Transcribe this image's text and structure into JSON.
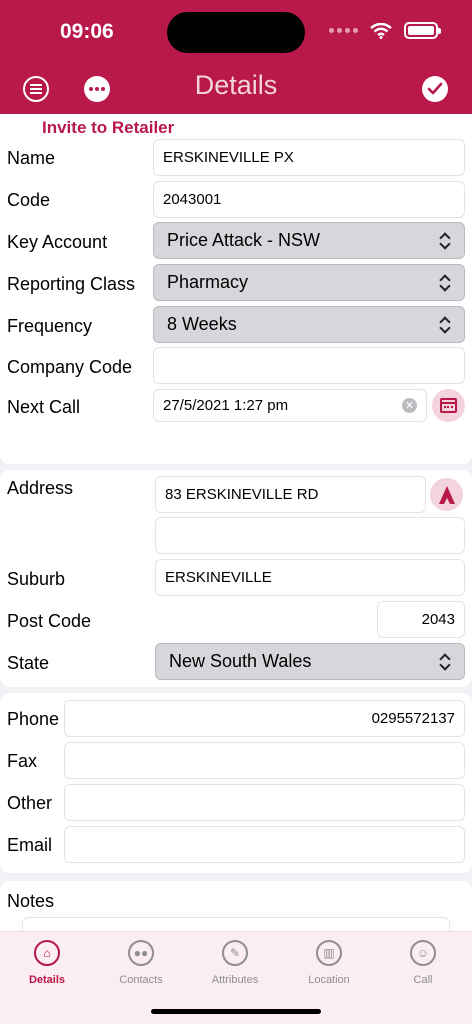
{
  "status_bar": {
    "time": "09:06"
  },
  "nav": {
    "title": "Details"
  },
  "details": {
    "invite_link": "Invite to Retailer",
    "name": {
      "label": "Name",
      "value": "ERSKINEVILLE PX"
    },
    "code": {
      "label": "Code",
      "value": "2043001"
    },
    "key_account": {
      "label": "Key Account",
      "value": "Price Attack - NSW"
    },
    "reporting_class": {
      "label": "Reporting Class",
      "value": "Pharmacy"
    },
    "frequency": {
      "label": "Frequency",
      "value": "8 Weeks"
    },
    "company_code": {
      "label": "Company Code",
      "value": ""
    },
    "next_call": {
      "label": "Next Call",
      "value": "27/5/2021 1:27 pm"
    }
  },
  "address": {
    "address": {
      "label": "Address",
      "line1": "83 ERSKINEVILLE RD",
      "line2": ""
    },
    "suburb": {
      "label": "Suburb",
      "value": "ERSKINEVILLE"
    },
    "post_code": {
      "label": "Post Code",
      "value": "2043"
    },
    "state": {
      "label": "State",
      "value": "New South Wales"
    }
  },
  "contact": {
    "phone": {
      "label": "Phone",
      "value": "0295572137"
    },
    "fax": {
      "label": "Fax",
      "value": ""
    },
    "other": {
      "label": "Other",
      "value": ""
    },
    "email": {
      "label": "Email",
      "value": ""
    }
  },
  "notes": {
    "label": "Notes",
    "value": ""
  },
  "tabs": [
    {
      "label": "Details",
      "icon": "home-icon",
      "active": true
    },
    {
      "label": "Contacts",
      "icon": "contacts-icon",
      "active": false
    },
    {
      "label": "Attributes",
      "icon": "wrench-icon",
      "active": false
    },
    {
      "label": "Location",
      "icon": "map-icon",
      "active": false
    },
    {
      "label": "Call",
      "icon": "walking-person-icon",
      "active": false
    }
  ],
  "colors": {
    "accent": "#b8184a",
    "accent_light": "#f3d3dc",
    "background": "#f2f1f6"
  }
}
